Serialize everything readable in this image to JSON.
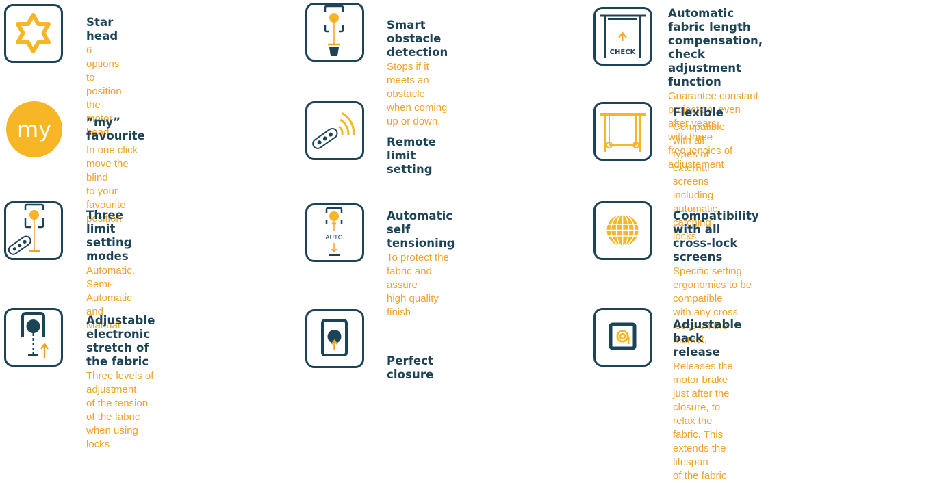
{
  "features": [
    {
      "title": "Star head",
      "desc_lines": [
        "6 options to position",
        "the motor head"
      ],
      "icon": "star-icon"
    },
    {
      "title": "Smart obstacle detection",
      "desc_lines": [
        "Stops if it meets an obstacle",
        "when coming up or down."
      ],
      "icon": "obstacle-icon"
    },
    {
      "title_lines": [
        "Automatic fabric length compensation,",
        "check adjustment function"
      ],
      "desc_lines": [
        "Guarantee constant projection, even after years,",
        "with three frequencies of adjustement"
      ],
      "icon": "check-icon",
      "icon_text": "CHECK"
    },
    {
      "title": "“my” favourite",
      "desc_lines": [
        "In one click move  the blind",
        "to your favourite position"
      ],
      "icon": "my-icon",
      "icon_text": "my"
    },
    {
      "title": "Remote limit setting",
      "icon": "remote-icon"
    },
    {
      "title": "Flexible",
      "desc_lines": [
        "Compatible with all types of external screens",
        "including automatic catching locks"
      ],
      "icon": "frame-icon"
    },
    {
      "title_lines": [
        "Three limit",
        "setting modes"
      ],
      "desc_lines": [
        "Automatic, Semi-Automatic",
        "and Manual"
      ],
      "icon": "limit-modes-icon"
    },
    {
      "title": "Automatic self tensioning",
      "desc_lines": [
        "To protect the fabric and assure",
        "high quality finish"
      ],
      "icon": "auto-tension-icon",
      "icon_text": "AUTO"
    },
    {
      "title": "Compatibility with all cross-lock screens",
      "desc_lines": [
        "Specific setting ergonomics to be compatible",
        "with any cross locks on the market."
      ],
      "icon": "globe-icon"
    },
    {
      "title_lines": [
        "Adjustable electronic",
        "stretch of the fabric"
      ],
      "desc_lines": [
        "Three levels of adjustment",
        "of the tension of the fabric",
        "when using locks"
      ],
      "icon": "stretch-icon"
    },
    {
      "title": "Perfect closure",
      "icon": "closure-icon"
    },
    {
      "title": "Adjustable back release",
      "desc_lines": [
        "Releases the motor brake just after the closure, to",
        "relax the fabric. This extends the lifespan",
        "of the fabric"
      ],
      "icon": "back-release-icon"
    }
  ],
  "colors": {
    "navy": "#1d4356",
    "orange": "#f0a32c",
    "yellow": "#f6b625"
  }
}
